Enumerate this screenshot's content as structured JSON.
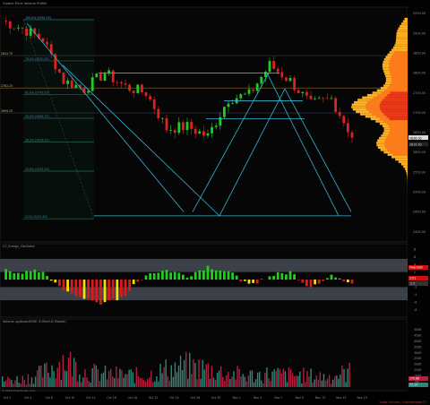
{
  "header": {
    "title": "Globex Price Volume Profile"
  },
  "main_price_panel": {
    "fib_labels": [
      "100.0% (2934.25)",
      "78.6% (2830.50)",
      "61.8% (2745.25)",
      "50.0% (2685.75)",
      "38.2% (2626.25)",
      "23.6% (2552.50)",
      "0.0% (2432.50)"
    ],
    "level_labels": [
      "2843.75",
      "2762.25",
      "2699.25"
    ],
    "price_axis": [
      "2950.00",
      "2900.00",
      "2850.00",
      "2800.00",
      "2750.00",
      "2700.00",
      "2650.00",
      "2600.00",
      "2550.00",
      "2500.00",
      "2450.00",
      "2400.00"
    ],
    "last_price_badges": [
      "2636.00",
      "2619.50"
    ]
  },
  "oscillator_panel": {
    "title": "CC_Energy_Oscillator",
    "axis": [
      "8",
      "6",
      "4",
      "2",
      "0",
      "-2",
      "-4",
      "-6",
      "-8"
    ],
    "badges": [
      "OverSold",
      "3.01",
      "-2.5"
    ]
  },
  "volume_panel": {
    "title": "Volume up/down/NYSE (E-Mini/US Market)",
    "axis": [
      "500K",
      "450K",
      "400K",
      "350K",
      "300K",
      "250K",
      "200K",
      "150K",
      "100K",
      "50K"
    ],
    "badges": [
      "175.68",
      "77.14"
    ]
  },
  "time_axis": [
    "Oct 2",
    "Oct 4",
    "Oct 8",
    "Oct 10",
    "Oct 12",
    "Oct 16",
    "Oct 18",
    "Oct 22",
    "Oct 24",
    "Oct 26",
    "Oct 30",
    "Nov 1",
    "Nov 5",
    "Nov 7",
    "Nov 9",
    "Nov 13",
    "Nov 15",
    "Nov 19"
  ],
  "footer": {
    "copyright": "© 2018 NinjaTrader, LLC",
    "watermark": "Trade Futures / futurestrader71"
  },
  "colors": {
    "up_candle": "#22cc22",
    "down_candle": "#dd2222",
    "channel_line": "#33b5d0",
    "fib_line": "#2f7a5a",
    "profile_core": "#e8301a",
    "profile_mid": "#ff7a1a",
    "profile_outer": "#ffb020",
    "osc_up": "#22cc22",
    "osc_down": "#dd1a1a",
    "osc_warn": "#f2e000",
    "vol_up": "#2a8a7a",
    "vol_down": "#b02040"
  },
  "chart_data": [
    {
      "type": "line",
      "name": "ES price (approx. closes)",
      "x": [
        "Oct 2",
        "Oct 4",
        "Oct 8",
        "Oct 10",
        "Oct 12",
        "Oct 16",
        "Oct 18",
        "Oct 22",
        "Oct 24",
        "Oct 26",
        "Oct 30",
        "Nov 1",
        "Nov 5",
        "Nov 7",
        "Nov 9",
        "Nov 13",
        "Nov 15",
        "Nov 19"
      ],
      "values": [
        2932,
        2912,
        2885,
        2780,
        2760,
        2800,
        2765,
        2750,
        2660,
        2665,
        2640,
        2735,
        2745,
        2820,
        2780,
        2720,
        2735,
        2640
      ],
      "ylim": [
        2400,
        2960
      ]
    },
    {
      "type": "bar",
      "name": "CC_Energy_Oscillator",
      "values": [
        2.5,
        2,
        2.2,
        -3,
        -5,
        -6.5,
        -4,
        1.5,
        2.5,
        1,
        3.5,
        2,
        -1.5,
        1,
        2,
        -2,
        1.5,
        -1
      ],
      "ylim": [
        -8,
        8
      ]
    },
    {
      "type": "bar",
      "name": "Volume",
      "values": [
        80,
        95,
        160,
        320,
        180,
        150,
        140,
        130,
        200,
        240,
        210,
        160,
        130,
        150,
        140,
        130,
        120,
        175
      ],
      "ylim": [
        0,
        500
      ]
    }
  ]
}
